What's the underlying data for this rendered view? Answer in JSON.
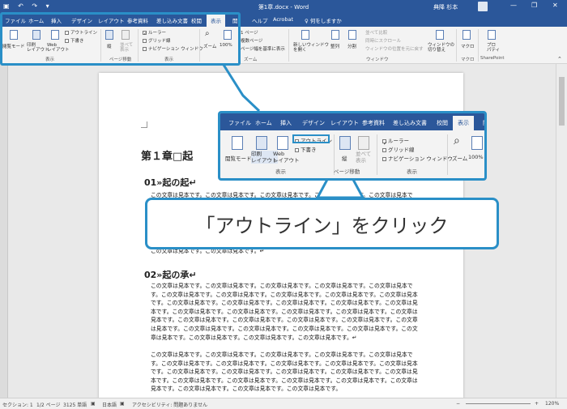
{
  "window": {
    "qat_icons": "▣ ↶ ↷ ▾",
    "title": "第1章.docx - Word",
    "user": "典降 杉本",
    "controls": {
      "minimize": "—",
      "restore": "❐",
      "close": "✕"
    }
  },
  "ribbon_tabs": [
    "ファイル",
    "ホーム",
    "挿入",
    "デザイン",
    "レイアウト",
    "参考資料",
    "差し込み文書",
    "校閲",
    "表示",
    "開",
    "ヘルプ",
    "Acrobat",
    "♀ 何をしますか"
  ],
  "ribbon": {
    "views": {
      "read_mode": "閲覧モード",
      "print_layout": "印刷\nレイアウト",
      "web_layout": "Web\nレイアウト",
      "outline": "アウトライン",
      "draft": "下書き",
      "group": "表示"
    },
    "page_move": {
      "vertical": "縦",
      "side": "並べて\n表示",
      "group": "ページ移動"
    },
    "show": {
      "ruler": "ルーラー",
      "gridlines": "グリッド線",
      "nav_pane": "ナビゲーション ウィンドウ",
      "group": "表示"
    },
    "zoom": {
      "zoom": "ズーム",
      "100": "100%",
      "one_page": "1 ページ",
      "multi_page": "複数ページ",
      "page_width": "ページ幅を基準に表示",
      "group": "ズーム"
    },
    "window": {
      "new_window": "新しいウィンドウ\nを開く",
      "arrange": "整列",
      "split": "分割",
      "side_by_side": "並べて比較",
      "sync_scroll": "同時にスクロール",
      "reset_pos": "ウィンドウの位置を元に戻す",
      "switch": "ウィンドウの\n切り替え",
      "group": "ウィンドウ"
    },
    "macro": {
      "macro": "マクロ",
      "group": "マクロ"
    },
    "sharepoint": {
      "properties": "プロ\nパティ",
      "group": "SharePoint"
    }
  },
  "document": {
    "chapter_title": "第１章□起",
    "section1_title": "01»起の起↵",
    "section1_text": "この文章は見本です。この文章は見本です。この文章は見本です。この文章は見本です。この文章は見本です。この文章は見本です。この文章は見本です。この文章は見本です。この文章は見本です。",
    "section1_tail": "この文章は見本です。この文章は見本です。↵",
    "section2_title": "02»起の承↵",
    "section2_text": "この文章は見本です。この文章は見本です。この文章は見本です。この文章は見本です。この文章は見本です。この文章は見本です。この文章は見本です。この文章は見本です。この文章は見本です。この文章は見本です。この文章は見本です。この文章は見本です。この文章は見本です。この文章は見本です。この文章は見本です。この文章は見本です。この文章は見本です。この文章は見本です。この文章は見本です。この文章は見本です。この文章は見本です。この文章は見本です。この文章は見本です。この文章は見本です。この文章は見本です。この文章は見本です。この文章は見本です。この文章は見本です。この文章は見本です。この文章は見本です。この文章は見本です。この文章は見本です。この文章は見本です。↵",
    "section2_text_b": "この文章は見本です。この文章は見本です。この文章は見本です。この文章は見本です。この文章は見本です。この文章は見本です。この文章は見本です。この文章は見本です。この文章は見本です。この文章は見本です。この文章は見本です。この文章は見本です。この文章は見本です。この文章は見本です。この文章は見本です。この文章は見本です。この文章は見本です。この文章は見本です。この文章は見本です。この文章は見本です。この文章は見本です。この文章は見本です。この文章は見本です。"
  },
  "statusbar": {
    "section": "セクション: 1",
    "page": "1/2 ページ",
    "words": "3125 単語",
    "proof_icon": "▣",
    "language": "日本語",
    "macro_icon": "▣",
    "accessibility": "アクセシビリティ: 問題ありません",
    "zoom_minus": "−",
    "zoom_plus": "+",
    "zoom": "120%"
  },
  "callout": {
    "tabs": [
      "ファイル",
      "ホーム",
      "挿入",
      "デザイン",
      "レイアウト",
      "参考資料",
      "差し込み文書",
      "校閲",
      "表示",
      "開"
    ],
    "read_mode": "閲覧モード",
    "print_layout": "印刷\nレイアウト",
    "web_layout": "Web\nレイアウト",
    "outline": "アウトライン",
    "draft": "下書き",
    "views_group": "表示",
    "vertical": "縦",
    "side": "並べて\n表示",
    "page_move_group": "ページ移動",
    "ruler": "ルーラー",
    "gridlines": "グリッド線",
    "nav_pane": "ナビゲーション ウィンドウ",
    "show_group": "表示",
    "zoom": "ズーム",
    "zoom_100": "100%"
  },
  "instruction": "「アウトライン」をクリック",
  "colors": {
    "accent": "#2a8fc7",
    "word_blue": "#2b579a",
    "ribbon_bg": "#f3f3f3"
  }
}
